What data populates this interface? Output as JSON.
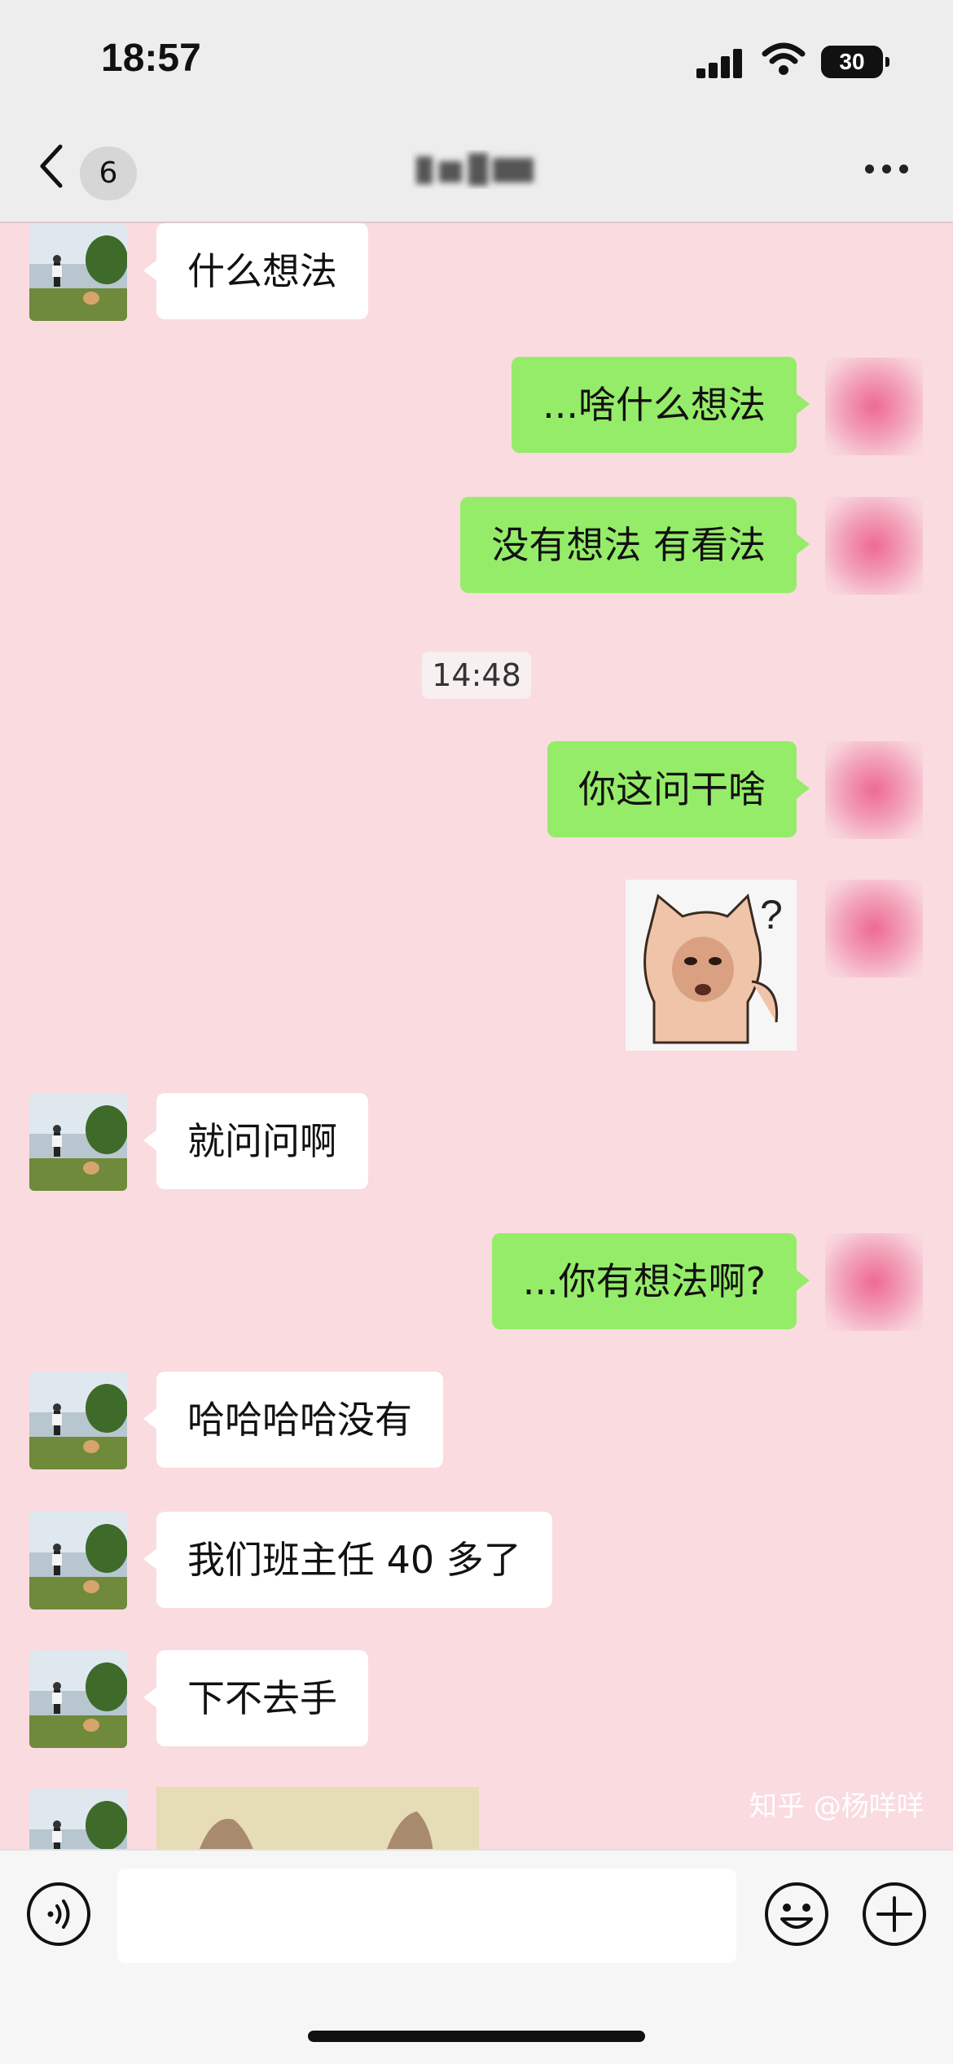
{
  "status": {
    "time": "18:57",
    "battery": "30"
  },
  "nav": {
    "back_count": "6"
  },
  "messages": [
    {
      "side": "left",
      "text": "什么想法"
    },
    {
      "side": "right",
      "text": "...啥什么想法"
    },
    {
      "side": "right",
      "text": "没有想法 有看法"
    },
    {
      "timestamp": "14:48"
    },
    {
      "side": "right",
      "text": "你这问干啥"
    },
    {
      "side": "right",
      "sticker": "question-bear-sticker"
    },
    {
      "side": "left",
      "text": "就问问啊"
    },
    {
      "side": "right",
      "text": "...你有想法啊?"
    },
    {
      "side": "left",
      "text": "哈哈哈哈没有"
    },
    {
      "side": "left",
      "text": "我们班主任 40 多了"
    },
    {
      "side": "left",
      "text": "下不去手"
    },
    {
      "side": "left",
      "image": "partial-photo"
    }
  ],
  "watermark": "知乎 @杨咩咩",
  "colors": {
    "chat_bg": "#fadbe0",
    "sent_bubble": "#95ec69",
    "recv_bubble": "#ffffff",
    "bar_bg": "#ededed"
  }
}
